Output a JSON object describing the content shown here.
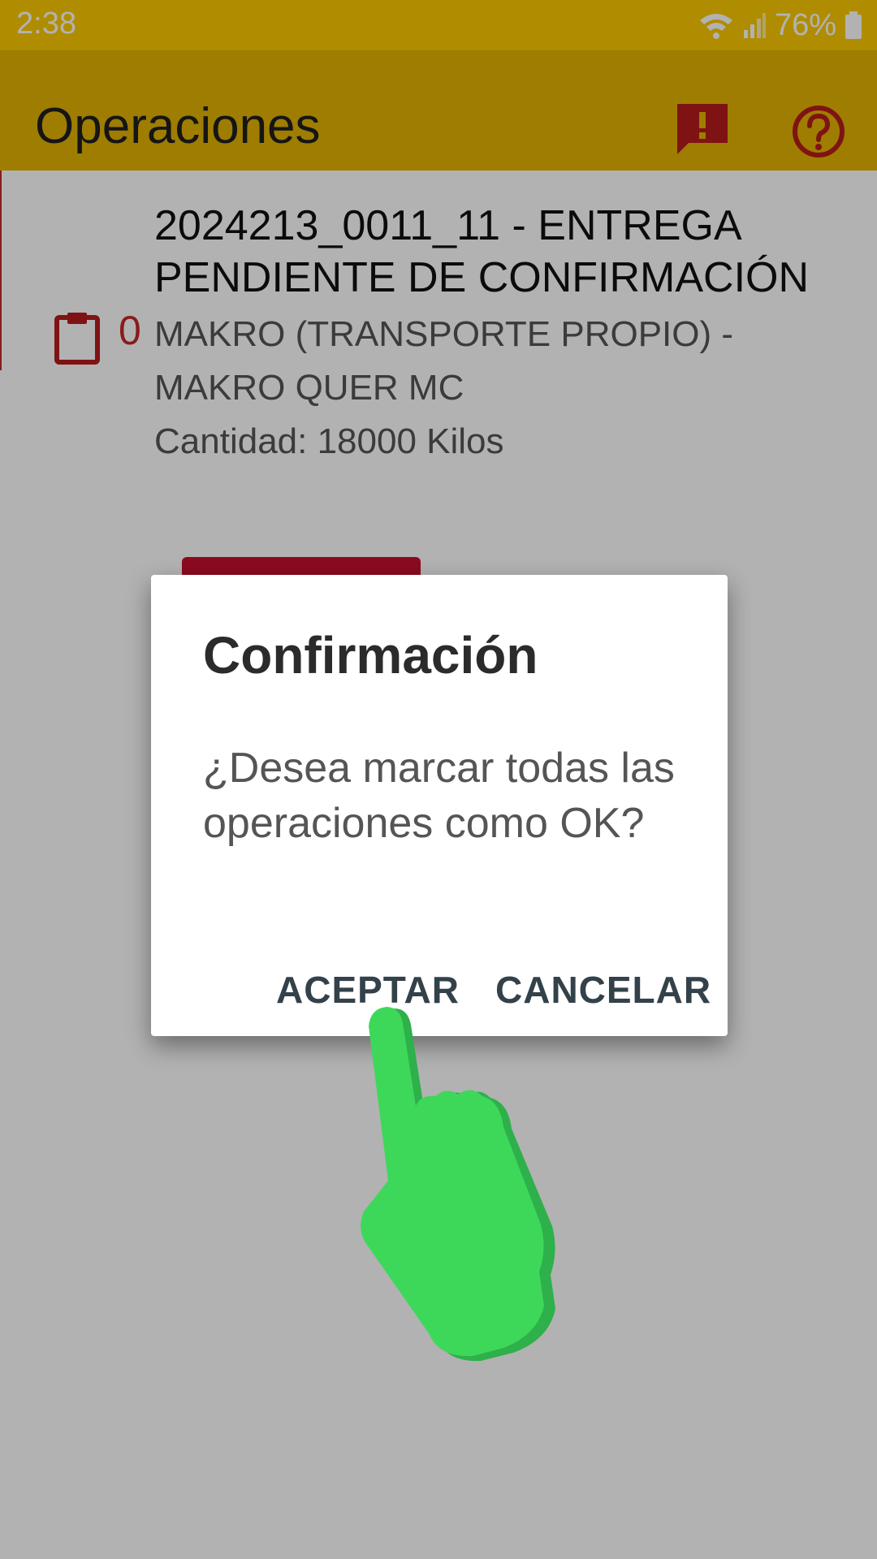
{
  "status_bar": {
    "time": "2:38",
    "battery": "76%"
  },
  "app_bar": {
    "title": "Operaciones"
  },
  "operation": {
    "title": "2024213_0011_11 - ENTREGA PENDIENTE DE CONFIRMACIÓN",
    "count": "0",
    "client_line1": "MAKRO (TRANSPORTE PROPIO) -",
    "client_line2": "MAKRO QUER MC",
    "quantity": "Cantidad: 18000 Kilos"
  },
  "dialog": {
    "title": "Confirmación",
    "message": "¿Desea marcar todas las operaciones como OK?",
    "accept_label": "ACEPTAR",
    "cancel_label": "CANCELAR"
  },
  "colors": {
    "status_bar": "#fcca00",
    "app_bar": "#e3b300",
    "accent_red": "#c8102e",
    "hand_green": "#3dd85a"
  }
}
